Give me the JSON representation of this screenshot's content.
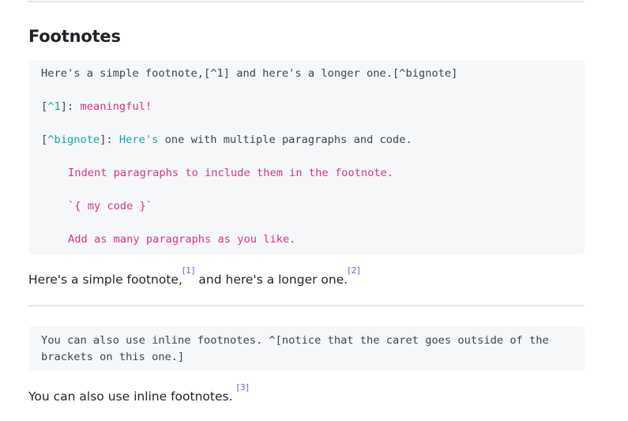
{
  "heading": "Footnotes",
  "code1": {
    "line1": "Here's a simple footnote,[^1] and here's a longer one.[^bignote]",
    "line2": {
      "open": "[",
      "ref": "^1",
      "sep": "]: ",
      "text": "meaningful!"
    },
    "line3": {
      "open": "[",
      "ref": "^bignote",
      "sep": "]: ",
      "heres": "Here's",
      "rest": " one with multiple paragraphs and code."
    },
    "line4": "Indent paragraphs to include them in the footnote.",
    "line5": "`{ my code }`",
    "line6": "Add as many paragraphs as you like."
  },
  "para1": {
    "text_a": "Here's a simple footnote,",
    "fn1": "[1]",
    "text_b": " and here's a longer one.",
    "fn2": "[2]"
  },
  "code2": {
    "line1": "You can also use inline footnotes. ^[notice that the caret goes outside of the",
    "line2": "brackets on this one.]"
  },
  "para2": {
    "text": "You can also use inline footnotes. ",
    "fn3": "[3]"
  }
}
